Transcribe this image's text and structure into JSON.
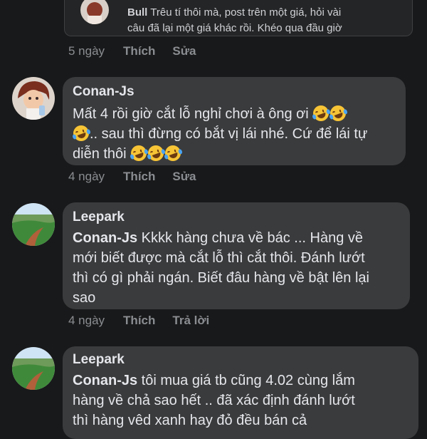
{
  "quoted": {
    "author": "Bull",
    "text_line1": "Trêu tí thôi mà, post trên một giá, hỏi vài",
    "text_line2": "câu đã lại một giá khác rồi. Khéo qua đầu giờ"
  },
  "quoted_actions": {
    "time": "5 ngày",
    "like": "Thích",
    "edit": "Sửa"
  },
  "comments": [
    {
      "author": "Conan-Js",
      "line1": "Mất 4 rồi giờ cắt lỗ nghỉ chơi à ông ơi",
      "line2": ".. sau thì đừng có bắt vị lái nhé. Cứ để lái tự",
      "line3": "diễn thôi",
      "actions": {
        "time": "4 ngày",
        "like": "Thích",
        "third": "Sửa"
      }
    },
    {
      "author": "Leepark",
      "mention": "Conan-Js",
      "line1": " Kkkk hàng chưa về bác ... Hàng về",
      "line2": "mới biết được mà cắt lỗ thì cắt thôi. Đánh lướt",
      "line3": "thì có gì phải ngán. Biết đâu hàng về bật lên lại",
      "line4": "sao",
      "actions": {
        "time": "4 ngày",
        "like": "Thích",
        "third": "Trả lời"
      }
    },
    {
      "author": "Leepark",
      "mention": "Conan-Js",
      "line1": " tôi mua giá tb cũng 4.02 cùng lắm",
      "line2": "hàng về chả sao hết .. đã xác định đánh lướt",
      "line3": "thì hàng vêd xanh hay đỏ đều bán cả"
    }
  ],
  "colors": {
    "background": "#18191a",
    "bubble": "#3a3b3c",
    "text": "#e4e6eb",
    "muted": "#8a8d91"
  },
  "icons": [
    "rolling-laughing-emoji"
  ]
}
